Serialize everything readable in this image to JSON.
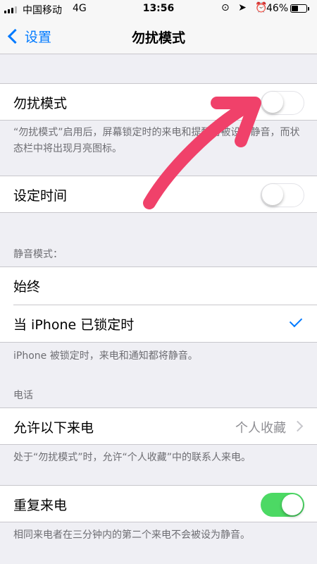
{
  "status_bar": {
    "carrier": "中国移动",
    "network": "4G",
    "time": "13:56",
    "icons": "⊙ ➤ ⏰",
    "battery_percent": "46%",
    "battery_level": 0.46
  },
  "nav": {
    "back_label": "设置",
    "title": "勿扰模式"
  },
  "dnd": {
    "label": "勿扰模式",
    "enabled": false,
    "footnote": "“勿扰模式”启用后，屏幕锁定时的来电和提醒将被设为静音，而状态栏中将出现月亮图标。"
  },
  "schedule": {
    "label": "设定时间",
    "enabled": false
  },
  "silence": {
    "header": "静音模式：",
    "options": [
      "始终",
      "当 iPhone 已锁定时"
    ],
    "selected_index": 1,
    "footnote": "iPhone 被锁定时，来电和通知都将静音。"
  },
  "phone": {
    "header": "电话",
    "allow_calls_label": "允许以下来电",
    "allow_calls_value": "个人收藏",
    "footnote": "处于“勿扰模式”时，允许“个人收藏”中的联系人来电。"
  },
  "repeated": {
    "label": "重复来电",
    "enabled": true,
    "footnote": "相同来电者在三分钟内的第二个来电不会被设为静音。"
  },
  "colors": {
    "tint": "#007aff",
    "switch_on": "#4cd964",
    "annotation": "#f0416a"
  }
}
